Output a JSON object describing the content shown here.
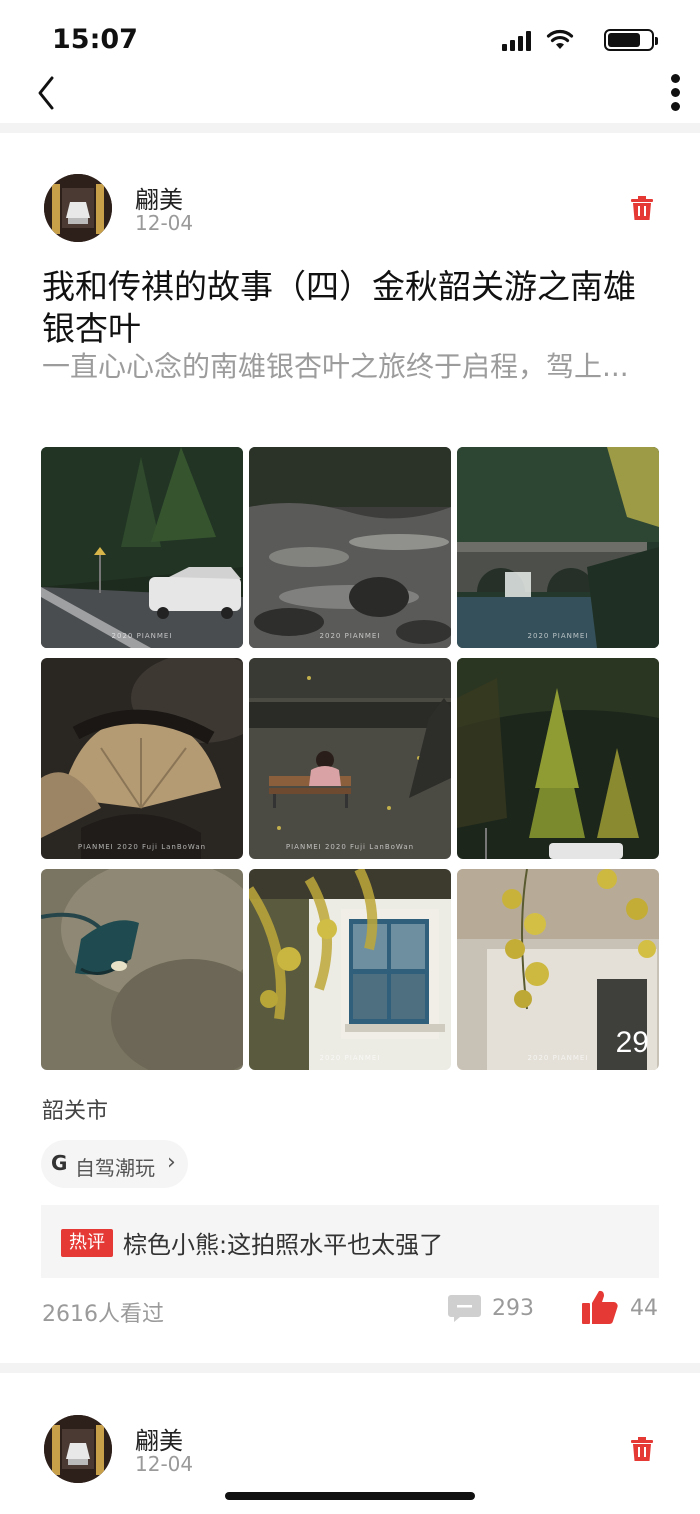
{
  "status_bar": {
    "time": "15:07"
  },
  "posts": [
    {
      "author": "翩美",
      "date": "12-04",
      "title": "我和传祺的故事（四）金秋韶关游之南雄银杏叶",
      "excerpt": "一直心心念的南雄银杏叶之旅终于启程，驾上...",
      "photos": [
        {
          "watermark": "2020 PIANMEI"
        },
        {
          "watermark": "2020 PIANMEI"
        },
        {
          "watermark": "2020 PIANMEI"
        },
        {
          "watermark": "PIANMEI 2020 Fuji LanBoWan"
        },
        {
          "watermark": "PIANMEI 2020 Fuji LanBoWan"
        },
        {
          "watermark": ""
        },
        {
          "watermark": ""
        },
        {
          "watermark": "2020 PIANMEI"
        },
        {
          "watermark": "2020 PIANMEI"
        }
      ],
      "photo_count": "29",
      "location": "韶关市",
      "tag": {
        "icon": "G",
        "label": "自驾潮玩"
      },
      "hot_comment": {
        "badge": "热评",
        "text": "棕色小熊:这拍照水平也太强了"
      },
      "views": "2616人看过",
      "comments": "293",
      "likes": "44"
    },
    {
      "author": "翩美",
      "date": "12-04"
    }
  ],
  "colors": {
    "accent": "#e53935",
    "muted": "#9a9a9a",
    "separator": "#f3f3f3"
  }
}
